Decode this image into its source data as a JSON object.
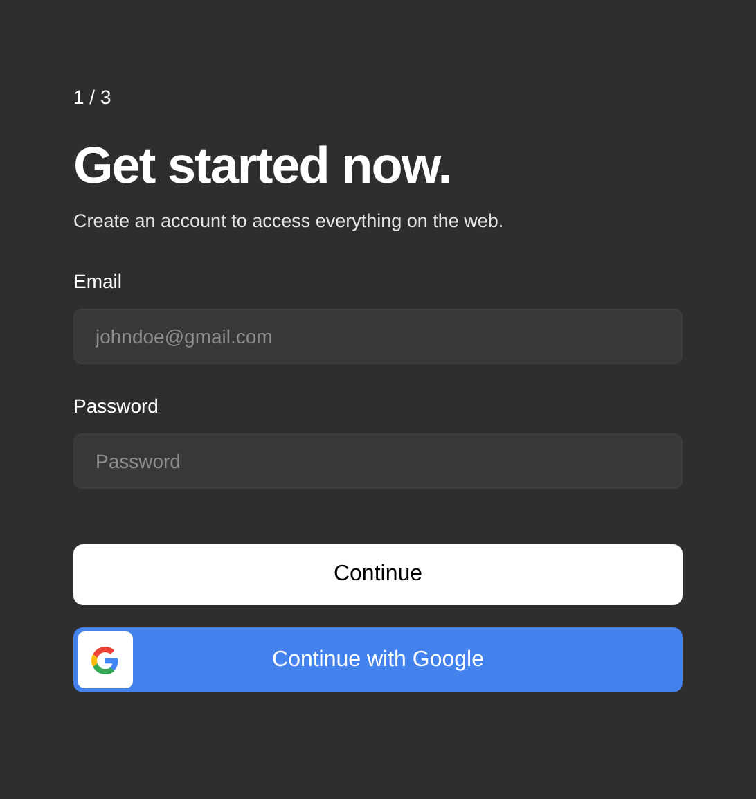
{
  "step": "1 / 3",
  "title": "Get started now.",
  "subtitle": "Create an account to access everything on the web.",
  "fields": [
    {
      "label": "Email",
      "placeholder": "johndoe@gmail.com"
    },
    {
      "label": "Password",
      "placeholder": "Password"
    }
  ],
  "buttons": [
    {
      "label": "Continue",
      "kind": "primary"
    },
    {
      "label": "Continue with Google",
      "kind": "google"
    }
  ]
}
